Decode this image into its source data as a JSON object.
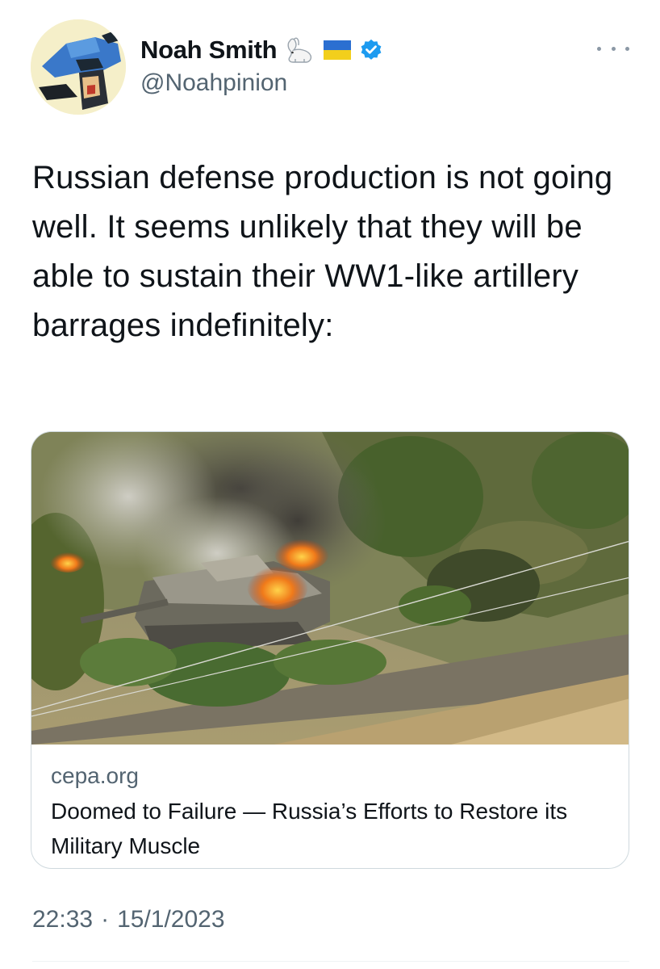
{
  "author": {
    "display_name": "Noah Smith",
    "handle": "@Noahpinion",
    "badges": [
      "rabbit-icon",
      "ukraine-flag-icon",
      "verified-badge-icon"
    ],
    "avatar": "cartoon-robot-avatar"
  },
  "tweet": {
    "text": "Russian defense production is not going well. It seems unlikely that they will be able to sustain their WW1-like artillery barrages indefinitely:"
  },
  "link_card": {
    "domain": "cepa.org",
    "title": "Doomed to Failure — Russia’s Efforts to Restore its Military Muscle",
    "image": "burning-tank-photo"
  },
  "meta": {
    "time": "22:33",
    "separator": "·",
    "date": "15/1/2023"
  },
  "colors": {
    "text": "#0f1419",
    "secondary": "#536471",
    "verified": "#1d9bf0",
    "border": "#cfd9de"
  }
}
